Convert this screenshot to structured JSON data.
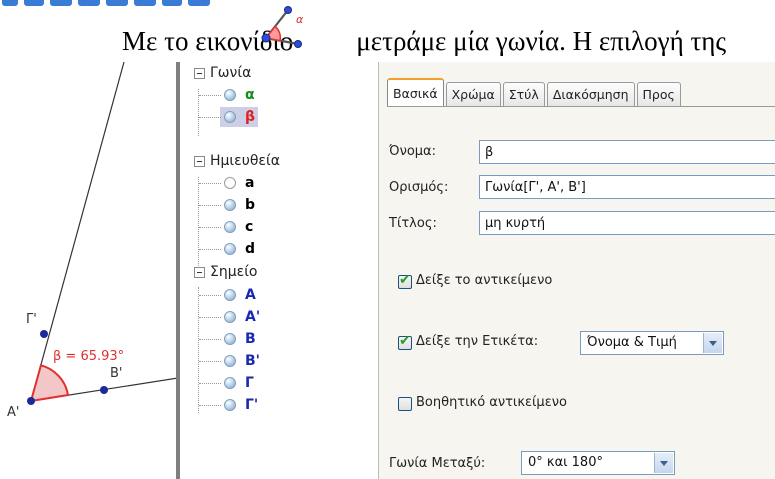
{
  "sentence": {
    "before_icon": "Με το εικονίδιο",
    "after_icon": "μετράμε μία γωνία. Η επιλογή της",
    "icon": "angle-tool-icon"
  },
  "geometry": {
    "point_labels": [
      "Γ'",
      "B'",
      "A'"
    ],
    "angle_label": "β = 65.93°",
    "colors": {
      "angle": "#e03030",
      "point": "#1a2a9a",
      "line": "#333333"
    }
  },
  "algebra": {
    "groups": [
      {
        "label": "Γωνία",
        "items": [
          {
            "name": "α",
            "color": "#1a8a1a",
            "selected": false,
            "hollow": false
          },
          {
            "name": "β",
            "color": "#e02020",
            "selected": true,
            "hollow": false
          }
        ]
      },
      {
        "label": "Ημιευθεία",
        "items": [
          {
            "name": "a",
            "color": "#111111",
            "selected": false,
            "hollow": true
          },
          {
            "name": "b",
            "color": "#111111",
            "selected": false,
            "hollow": false
          },
          {
            "name": "c",
            "color": "#111111",
            "selected": false,
            "hollow": false
          },
          {
            "name": "d",
            "color": "#111111",
            "selected": false,
            "hollow": false
          }
        ]
      },
      {
        "label": "Σημείο",
        "items": [
          {
            "name": "A",
            "color": "#1a2ab0",
            "selected": false,
            "hollow": false
          },
          {
            "name": "A'",
            "color": "#1a2ab0",
            "selected": false,
            "hollow": false
          },
          {
            "name": "B",
            "color": "#1a2ab0",
            "selected": false,
            "hollow": false
          },
          {
            "name": "B'",
            "color": "#1a2ab0",
            "selected": false,
            "hollow": false
          },
          {
            "name": "Γ",
            "color": "#1a2ab0",
            "selected": false,
            "hollow": false
          },
          {
            "name": "Γ'",
            "color": "#1a2ab0",
            "selected": false,
            "hollow": false
          }
        ]
      }
    ]
  },
  "properties": {
    "tabs": [
      "Βασικά",
      "Χρώμα",
      "Στύλ",
      "Διακόσμηση",
      "Προς"
    ],
    "active_tab": "Βασικά",
    "name_label": "Όνομα:",
    "name_value": "β",
    "definition_label": "Ορισμός:",
    "definition_value": "Γωνία[Γ', A', B']",
    "caption_label": "Τίτλος:",
    "caption_value": "μη κυρτή",
    "show_object_label": "Δείξε το αντικείμενο",
    "show_object_checked": true,
    "show_label_label": "Δείξε την Ετικέτα:",
    "show_label_checked": true,
    "label_mode_value": "Όνομα & Τιμή",
    "auxiliary_label": "Βοηθητικό αντικείμενο",
    "auxiliary_checked": false,
    "angle_between_label": "Γωνία Μεταξύ:",
    "angle_between_value": "0° και 180°"
  }
}
